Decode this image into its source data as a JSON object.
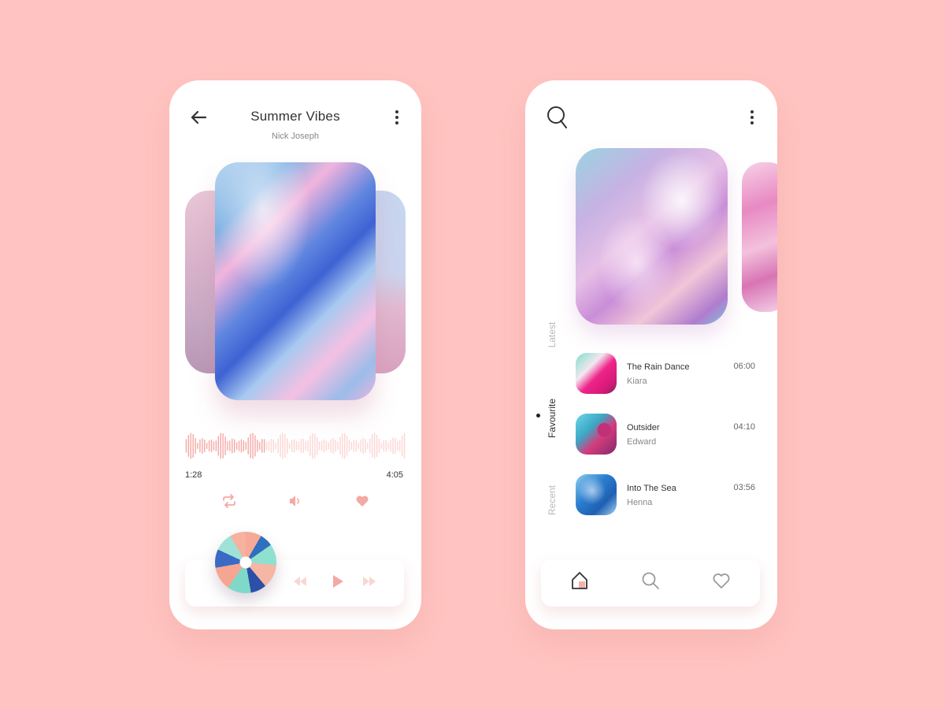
{
  "player": {
    "title": "Summer Vibes",
    "artist": "Nick Joseph",
    "time_current": "1:28",
    "time_total": "4:05",
    "progress": 0.36,
    "accent_color": "#f4a9a4",
    "icons": {
      "back": "arrow-left-icon",
      "more": "more-vertical-icon",
      "repeat": "repeat-icon",
      "volume": "volume-icon",
      "favorite": "heart-icon",
      "previous": "rewind-icon",
      "play": "play-icon",
      "next": "fast-forward-icon"
    }
  },
  "library": {
    "side_tabs": [
      "Latest",
      "Favourite",
      "Recent"
    ],
    "active_tab": "Favourite",
    "tracks": [
      {
        "title": "The Rain Dance",
        "artist": "Kiara",
        "duration": "06:00"
      },
      {
        "title": "Outsider",
        "artist": "Edward",
        "duration": "04:10"
      },
      {
        "title": "Into The Sea",
        "artist": "Henna",
        "duration": "03:56"
      }
    ],
    "nav": [
      {
        "icon": "home-icon",
        "active": true
      },
      {
        "icon": "search-icon",
        "active": false
      },
      {
        "icon": "heart-icon",
        "active": false
      }
    ]
  }
}
